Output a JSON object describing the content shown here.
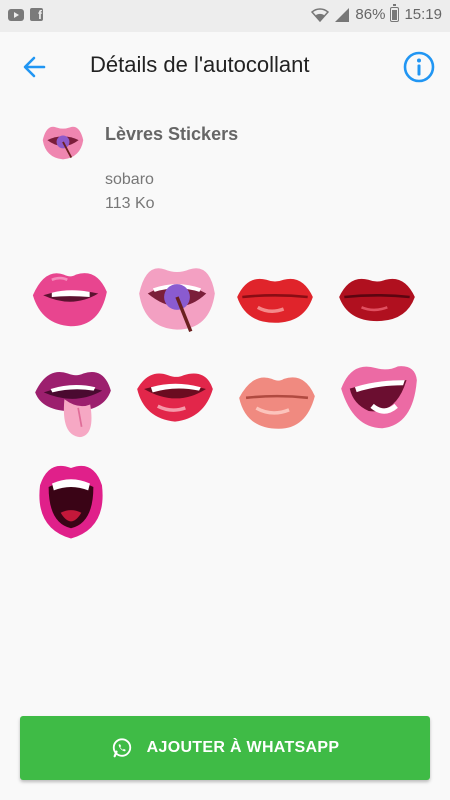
{
  "status_bar": {
    "battery_percent": "86%",
    "time": "15:19",
    "icons": [
      "youtube-icon",
      "facebook-icon",
      "wifi-icon",
      "signal-icon",
      "battery-icon"
    ]
  },
  "header": {
    "title": "Détails de l'autocollant",
    "back_icon": "arrow-left-icon",
    "info_icon": "info-icon"
  },
  "pack": {
    "name": "Lèvres Stickers",
    "author": "sobaro",
    "size": "113 Ko"
  },
  "stickers": [
    "pink-lips-teeth",
    "lips-lollipop",
    "red-lips",
    "dark-red-lips",
    "purple-lips-tongue",
    "red-lips-smile",
    "kiss-lips",
    "pink-lips-laugh",
    "open-mouth-lips"
  ],
  "actions": {
    "add_label": "AJOUTER À WHATSAPP",
    "add_icon": "whatsapp-icon"
  },
  "colors": {
    "accent": "#2196f3",
    "button": "#3fbb46"
  }
}
